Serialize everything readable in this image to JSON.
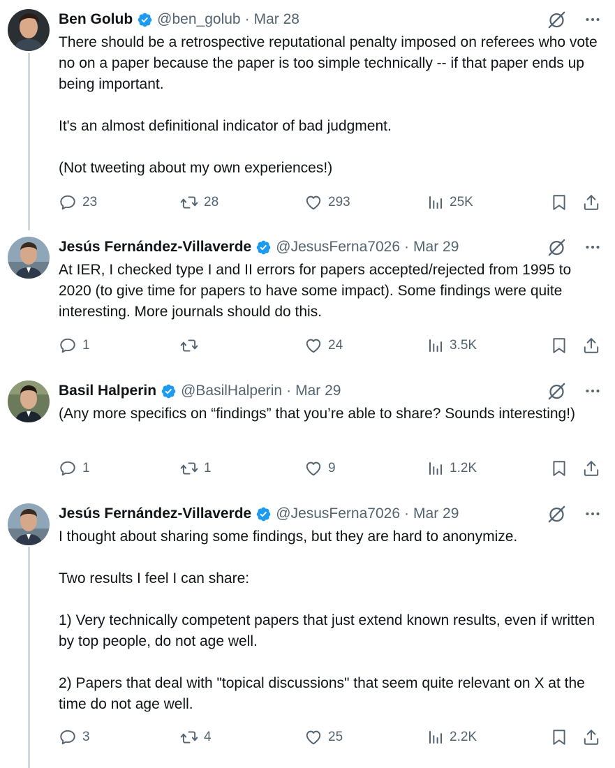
{
  "tweets": [
    {
      "name": "Ben Golub",
      "handle": "@ben_golub",
      "date": "Mar 28",
      "paragraphs": [
        "There should be a retrospective reputational penalty imposed on referees who vote no on a paper because the paper is too simple technically -- if that paper ends up being important.",
        "It's an almost definitional indicator of bad judgment.",
        "(Not tweeting about my own experiences!)"
      ],
      "replies": "23",
      "reposts": "28",
      "likes": "293",
      "views": "25K"
    },
    {
      "name": "Jesús Fernández-Villaverde",
      "handle": "@JesusFerna7026",
      "date": "Mar 29",
      "paragraphs": [
        "At IER, I checked type I and II errors for papers accepted/rejected from 1995 to 2020 (to give time for papers to have some impact). Some findings were quite interesting. More journals should do this."
      ],
      "replies": "1",
      "reposts": "",
      "likes": "24",
      "views": "3.5K"
    },
    {
      "name": "Basil Halperin",
      "handle": "@BasilHalperin",
      "date": "Mar 29",
      "paragraphs": [
        "(Any more specifics on “findings”  that you’re able to share? Sounds interesting!)"
      ],
      "replies": "1",
      "reposts": "1",
      "likes": "9",
      "views": "1.2K"
    },
    {
      "name": "Jesús Fernández-Villaverde",
      "handle": "@JesusFerna7026",
      "date": "Mar 29",
      "paragraphs": [
        "I thought about sharing some findings, but they are hard to anonymize.",
        "Two results I feel I can share:",
        "1) Very technically competent papers that just extend known results, even if written by top people, do not age well.",
        "2) Papers that deal with \"topical discussions\" that seem quite relevant on X at the time do not age well."
      ],
      "replies": "3",
      "reposts": "4",
      "likes": "25",
      "views": "2.2K"
    }
  ],
  "icons": {
    "reply": "reply-icon",
    "repost": "repost-icon",
    "like": "heart-icon",
    "views": "views-icon",
    "bookmark": "bookmark-icon",
    "share": "share-icon",
    "grok": "grok-icon",
    "more": "more-icon",
    "verified": "verified-badge-icon"
  },
  "colors": {
    "verified": "#1d9bf0",
    "text": "#0f1419",
    "muted": "#536471",
    "thread_line": "#cfd9de"
  }
}
